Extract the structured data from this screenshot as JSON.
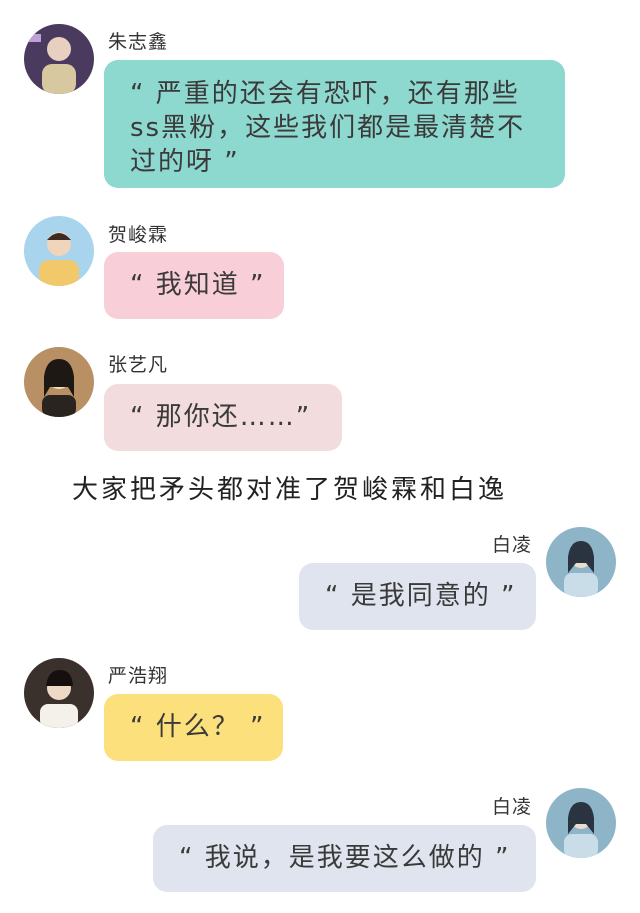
{
  "colors": {
    "teal": "#8dd8cf",
    "pink": "#f8cfd8",
    "rose": "#f2dcdd",
    "grayblue": "#dfe4ee",
    "yellow": "#fbe07c"
  },
  "messages": [
    {
      "name": "朱志鑫",
      "text": "“ 严重的还会有恐吓，还有那些ss黑粉，这些我们都是最清楚不过的呀 ”",
      "avatar": "avatar-icon"
    },
    {
      "name": "贺峻霖",
      "text": "“ 我知道 ”",
      "avatar": "avatar-icon"
    },
    {
      "name": "张艺凡",
      "text": "“ 那你还……”",
      "avatar": "avatar-icon"
    },
    {
      "name": "白凌",
      "text": "“ 是我同意的 ”",
      "avatar": "avatar-icon"
    },
    {
      "name": "严浩翔",
      "text": "“ 什么？ ”",
      "avatar": "avatar-icon"
    },
    {
      "name": "白凌",
      "text": "“ 我说，是我要这么做的 ”",
      "avatar": "avatar-icon"
    }
  ],
  "narration": "大家把矛头都对准了贺峻霖和白逸"
}
